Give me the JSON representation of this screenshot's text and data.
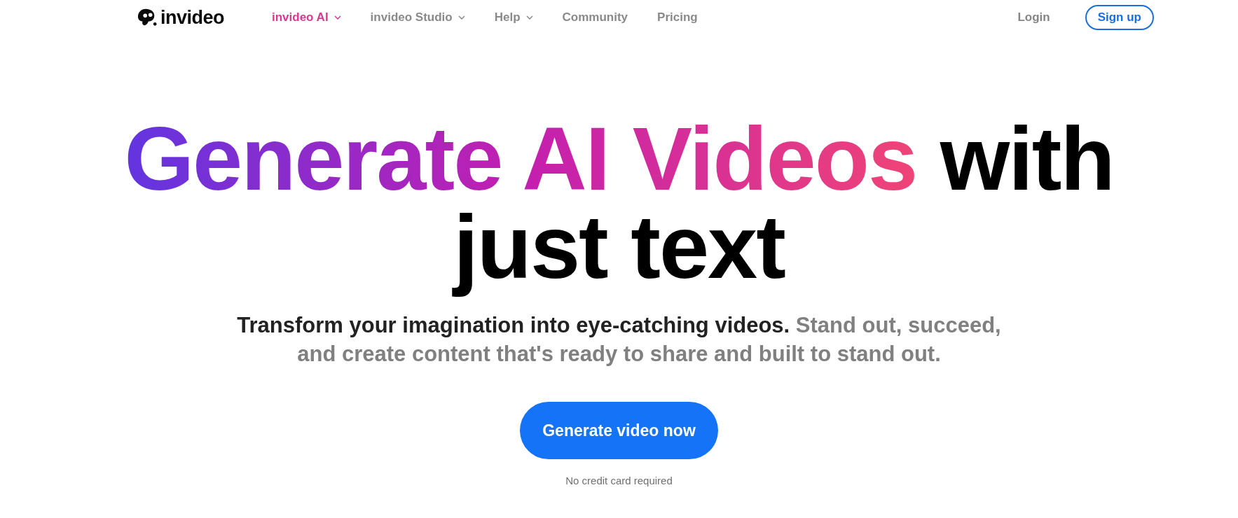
{
  "brand": "invideo",
  "nav": [
    {
      "label": "invideo AI",
      "selected": true,
      "has_menu": true
    },
    {
      "label": "invideo Studio",
      "selected": false,
      "has_menu": true
    },
    {
      "label": "Help",
      "selected": false,
      "has_menu": true
    },
    {
      "label": "Community",
      "selected": false,
      "has_menu": false
    },
    {
      "label": "Pricing",
      "selected": false,
      "has_menu": false
    }
  ],
  "login": "Login",
  "signup": "Sign up",
  "headline": {
    "highlight": "Generate AI Videos",
    "rest": "with just text"
  },
  "subtitle": {
    "lead": "Transform your imagination into eye-catching videos.",
    "rest": "Stand out, succeed, and create content that's ready to share and built to stand out."
  },
  "cta": "Generate video now",
  "note": "No credit card required"
}
